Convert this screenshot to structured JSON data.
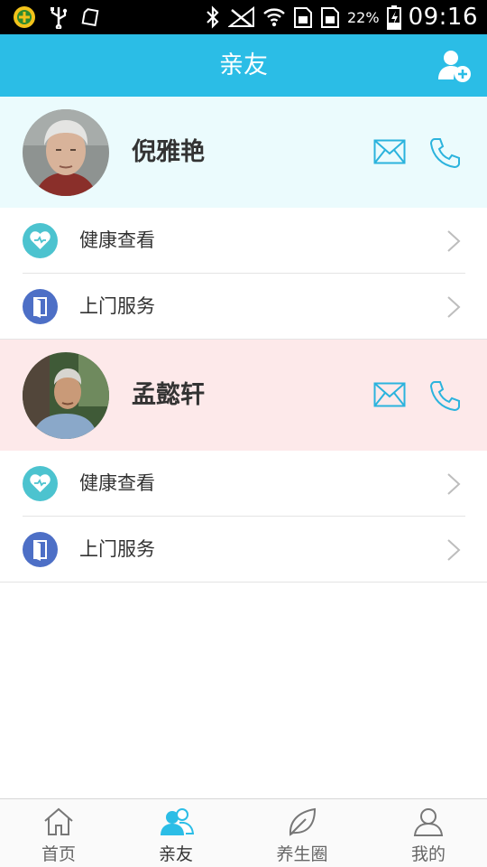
{
  "status_bar": {
    "battery_percent": "22%",
    "time": "09:16"
  },
  "header": {
    "title": "亲友",
    "add_icon": "add-contact-icon"
  },
  "contacts": [
    {
      "name": "倪雅艳",
      "header_bg": "#ebfbfd",
      "actions": [
        {
          "label": "健康查看",
          "icon": "heart-icon"
        },
        {
          "label": "上门服务",
          "icon": "door-icon"
        }
      ]
    },
    {
      "name": "孟懿轩",
      "header_bg": "#fde9ea",
      "actions": [
        {
          "label": "健康查看",
          "icon": "heart-icon"
        },
        {
          "label": "上门服务",
          "icon": "door-icon"
        }
      ]
    }
  ],
  "tabs": [
    {
      "label": "首页",
      "icon": "home-icon",
      "active": false
    },
    {
      "label": "亲友",
      "icon": "friends-icon",
      "active": true
    },
    {
      "label": "养生圈",
      "icon": "leaf-icon",
      "active": false
    },
    {
      "label": "我的",
      "icon": "profile-icon",
      "active": false
    }
  ],
  "colors": {
    "accent": "#2bbde6",
    "health_icon_bg": "#4cc3cf",
    "service_icon_bg": "#4d6fc6"
  }
}
